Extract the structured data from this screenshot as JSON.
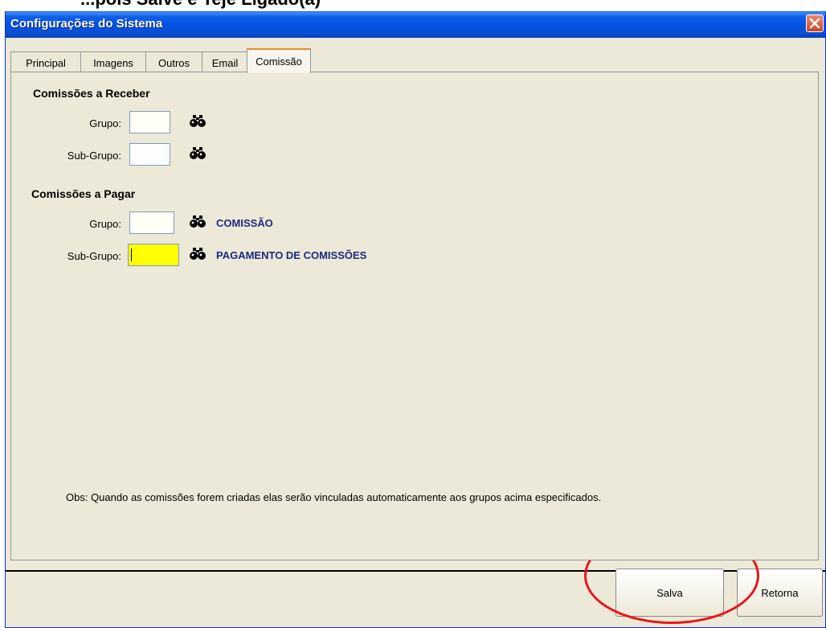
{
  "window": {
    "title": "Configurações do Sistema",
    "cut_heading": "...pois Salve e Teje Ligado(a)"
  },
  "tabs": [
    {
      "label": "Principal"
    },
    {
      "label": "Imagens"
    },
    {
      "label": "Outros"
    },
    {
      "label": "Email"
    },
    {
      "label": "Comissão"
    }
  ],
  "receber": {
    "title": "Comissões a Receber",
    "grupo_label": "Grupo:",
    "grupo_value": "",
    "subgrupo_label": "Sub-Grupo:",
    "subgrupo_value": ""
  },
  "pagar": {
    "title": "Comissões a Pagar",
    "grupo_label": "Grupo:",
    "grupo_value": "",
    "grupo_desc": "COMISSÃO",
    "subgrupo_label": "Sub-Grupo:",
    "subgrupo_value": "",
    "subgrupo_desc": "PAGAMENTO DE COMISSÕES"
  },
  "obs": "Obs: Quando as comissões forem criadas elas serão vinculadas automaticamente aos grupos acima especificados.",
  "buttons": {
    "save": "Salva",
    "back": "Retorna"
  },
  "colors": {
    "titlebar": "#0553e0",
    "focused_field": "#ffff00",
    "description_text": "#1b2a80",
    "annotation_circle": "#e8161a"
  },
  "icons": {
    "lookup": "binoculars-icon",
    "close": "close-icon"
  }
}
